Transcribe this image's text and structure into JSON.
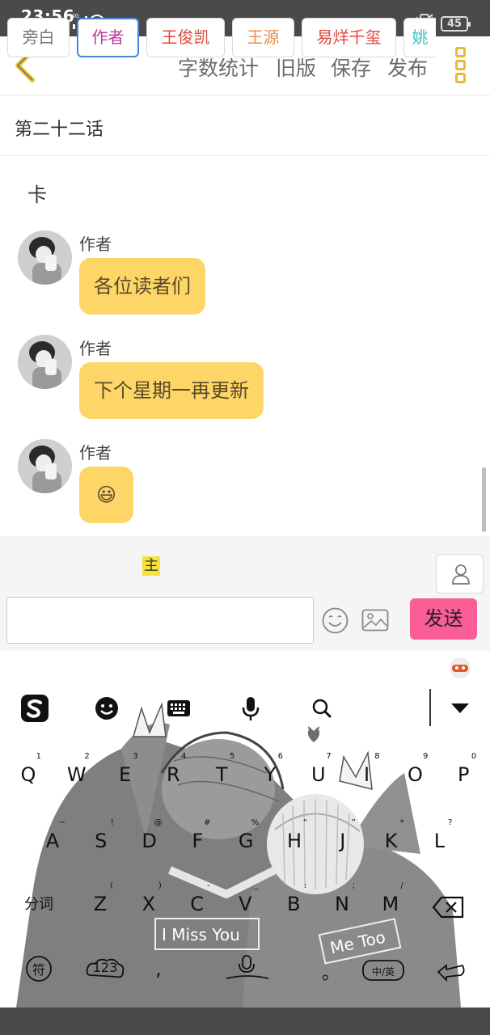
{
  "status_bar": {
    "time": "23:56",
    "network": "4G",
    "hd": "HD",
    "battery": "45"
  },
  "header": {
    "word_count": "字数统计",
    "old_version": "旧版",
    "save": "保存",
    "publish": "发布"
  },
  "chapter_title": "第二十二话",
  "narration": "卡",
  "messages": [
    {
      "sender": "作者",
      "text": "各位读者们"
    },
    {
      "sender": "作者",
      "text": "下个星期一再更新"
    },
    {
      "sender": "作者",
      "text": "😃"
    }
  ],
  "roles": [
    {
      "label": "旁白",
      "color": "#777777"
    },
    {
      "label": "作者",
      "color": "#c0379a"
    },
    {
      "label": "王俊凯",
      "color": "#e0473a"
    },
    {
      "label": "王源",
      "color": "#ef8a4e"
    },
    {
      "label": "易烊千玺",
      "color": "#e0473a"
    },
    {
      "label": "姚",
      "color": "#3cc1c4"
    }
  ],
  "main_tag": "主",
  "input": {
    "value": "",
    "placeholder": ""
  },
  "send_label": "发送",
  "accent_colors": {
    "bubble": "#fdd667",
    "send": "#fb5d96",
    "more": "#e8b93a"
  },
  "keyboard": {
    "row1": [
      {
        "k": "Q",
        "s": "1"
      },
      {
        "k": "W",
        "s": "2"
      },
      {
        "k": "E",
        "s": "3"
      },
      {
        "k": "R",
        "s": "4"
      },
      {
        "k": "T",
        "s": "5"
      },
      {
        "k": "Y",
        "s": "6"
      },
      {
        "k": "U",
        "s": "7"
      },
      {
        "k": "I",
        "s": "8"
      },
      {
        "k": "O",
        "s": "9"
      },
      {
        "k": "P",
        "s": "0"
      }
    ],
    "row2": [
      {
        "k": "A",
        "s": "~"
      },
      {
        "k": "S",
        "s": "!"
      },
      {
        "k": "D",
        "s": "@"
      },
      {
        "k": "F",
        "s": "#"
      },
      {
        "k": "G",
        "s": "%"
      },
      {
        "k": "H",
        "s": "“"
      },
      {
        "k": "J",
        "s": "”"
      },
      {
        "k": "K",
        "s": "*"
      },
      {
        "k": "L",
        "s": "?"
      }
    ],
    "row3": [
      {
        "k": "Z",
        "s": "("
      },
      {
        "k": "X",
        "s": ")"
      },
      {
        "k": "C",
        "s": "-"
      },
      {
        "k": "V",
        "s": "_"
      },
      {
        "k": "B",
        "s": ":"
      },
      {
        "k": "N",
        "s": ";"
      },
      {
        "k": "M",
        "s": "/"
      }
    ],
    "fenci": "分词",
    "symbols": "符",
    "numbers": "123",
    "comma": ",",
    "period": "。",
    "lang": "中/英",
    "art_text_left": "I Miss You",
    "art_text_right": "Me Too"
  }
}
